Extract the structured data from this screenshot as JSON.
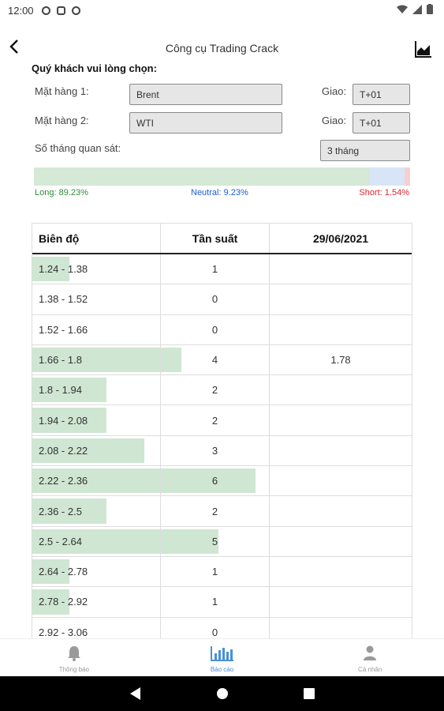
{
  "status": {
    "time": "12:00"
  },
  "header": {
    "title": "Công cụ Trading Crack",
    "back_icon": "back-arrow-icon",
    "action_icon": "area-chart-icon"
  },
  "form": {
    "prompt": "Quý khách vui lòng chọn:",
    "item1_label": "Mặt hàng 1:",
    "item1_value": "Brent",
    "delivery1_label": "Giao:",
    "delivery1_value": "T+01",
    "item2_label": "Mặt hàng 2:",
    "item2_value": "WTI",
    "delivery2_label": "Giao:",
    "delivery2_value": "T+01",
    "months_label": "Số tháng quan sát:",
    "months_value": "3 tháng"
  },
  "sentiment": {
    "long_label": "Long: 89.23%",
    "neutral_label": "Neutral: 9.23%",
    "short_label": "Short: 1.54%",
    "long": 89.23,
    "neutral": 9.23,
    "short": 1.54,
    "colors": {
      "long": "#2e8b3a",
      "neutral": "#1f5bd6",
      "short": "#e0242e"
    }
  },
  "table": {
    "headers": [
      "Biên độ",
      "Tần suất",
      "29/06/2021"
    ],
    "max_frequency": 6,
    "rows": [
      {
        "range": "1.24 - 1.38",
        "freq": "1",
        "value": "",
        "fill": 1
      },
      {
        "range": "1.38 - 1.52",
        "freq": "0",
        "value": "",
        "fill": 0
      },
      {
        "range": "1.52 - 1.66",
        "freq": "0",
        "value": "",
        "fill": 0
      },
      {
        "range": "1.66 - 1.8",
        "freq": "4",
        "value": "1.78",
        "fill": 4
      },
      {
        "range": "1.8 - 1.94",
        "freq": "2",
        "value": "",
        "fill": 2
      },
      {
        "range": "1.94 - 2.08",
        "freq": "2",
        "value": "",
        "fill": 2
      },
      {
        "range": "2.08 - 2.22",
        "freq": "3",
        "value": "",
        "fill": 3
      },
      {
        "range": "2.22 - 2.36",
        "freq": "6",
        "value": "",
        "fill": 6
      },
      {
        "range": "2.36 - 2.5",
        "freq": "2",
        "value": "",
        "fill": 2
      },
      {
        "range": "2.5 - 2.64",
        "freq": "5",
        "value": "",
        "fill": 5
      },
      {
        "range": "2.64 - 2.78",
        "freq": "1",
        "value": "",
        "fill": 1
      },
      {
        "range": "2.78 - 2.92",
        "freq": "1",
        "value": "",
        "fill": 1
      },
      {
        "range": "2.92 - 3.06",
        "freq": "0",
        "value": "",
        "fill": 0
      }
    ]
  },
  "tabs": [
    {
      "label": "Thông báo",
      "icon": "bell-icon",
      "active": false
    },
    {
      "label": "Báo cáo",
      "icon": "bar-chart-icon",
      "active": true
    },
    {
      "label": "Cá nhân",
      "icon": "person-icon",
      "active": false
    }
  ]
}
